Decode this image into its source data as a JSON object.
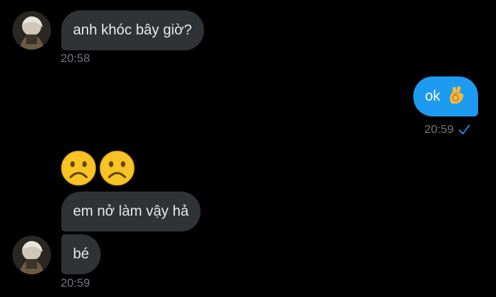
{
  "conversation": {
    "messages": [
      {
        "sender": "them",
        "text": "anh khóc bây giờ?",
        "time": "20:58"
      },
      {
        "sender": "me",
        "text": "ok",
        "emoji": "ok-hand-icon",
        "time": "20:59",
        "status": "sent-check-icon"
      },
      {
        "sender": "them",
        "emojis": [
          "frowning-face-icon",
          "frowning-face-icon"
        ]
      },
      {
        "sender": "them",
        "text": "em nở làm vậy hả"
      },
      {
        "sender": "them",
        "text": "bé",
        "time": "20:59"
      }
    ]
  },
  "colors": {
    "background": "#000000",
    "incoming_bubble": "#2f3336",
    "outgoing_bubble": "#1d9bf0",
    "timestamp": "#71767b",
    "check": "#1d9bf0"
  }
}
